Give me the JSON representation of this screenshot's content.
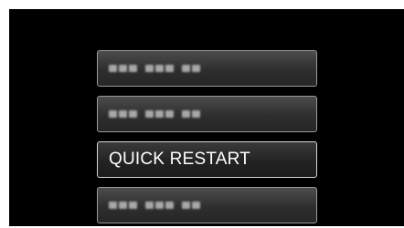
{
  "menu": {
    "items": [
      {
        "label": "",
        "masked": true,
        "selected": false
      },
      {
        "label": "",
        "masked": true,
        "selected": false
      },
      {
        "label": "QUICK RESTART",
        "masked": false,
        "selected": true
      },
      {
        "label": "",
        "masked": true,
        "selected": false
      }
    ]
  },
  "colors": {
    "screen_background": "#000000",
    "item_border": "#9a9a9a",
    "selected_border": "#d6d6d6",
    "text": "#ffffff"
  }
}
